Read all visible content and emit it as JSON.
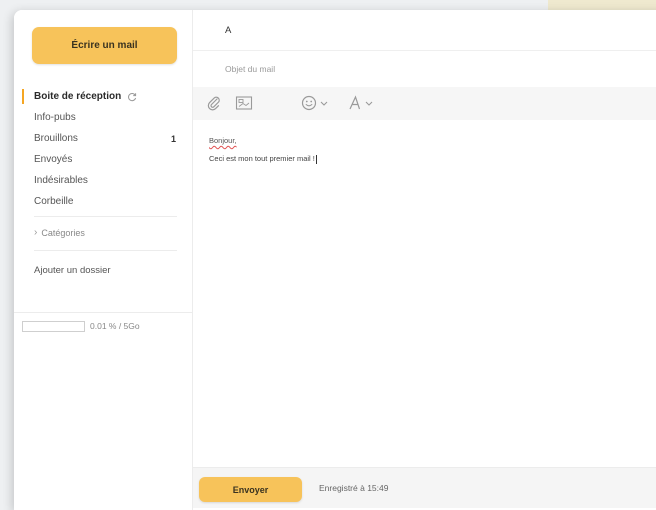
{
  "compose": {
    "label": "Écrire un mail"
  },
  "folders": [
    {
      "label": "Boite de réception",
      "active": true
    },
    {
      "label": "Info-pubs"
    },
    {
      "label": "Brouillons",
      "count": "1"
    },
    {
      "label": "Envoyés"
    },
    {
      "label": "Indésirables"
    },
    {
      "label": "Corbeille"
    }
  ],
  "categories_label": "Catégories",
  "add_folder_label": "Ajouter un dossier",
  "quota": {
    "text": "0.01 % / 5Go",
    "fraction": 0.0001
  },
  "mail": {
    "to_label": "A",
    "subject_placeholder": "Objet du mail",
    "greeting": "Bonjour,",
    "body": "Ceci est mon tout premier mail !"
  },
  "footer": {
    "send_label": "Envoyer",
    "saved_text": "Enregistré à 15:49"
  },
  "colors": {
    "accent": "#f7c35a",
    "active_marker": "#f5a623"
  },
  "icons": [
    "refresh-icon",
    "chevron-right-icon",
    "attach-icon",
    "image-icon",
    "emoji-icon",
    "font-icon",
    "chevron-down-icon"
  ]
}
